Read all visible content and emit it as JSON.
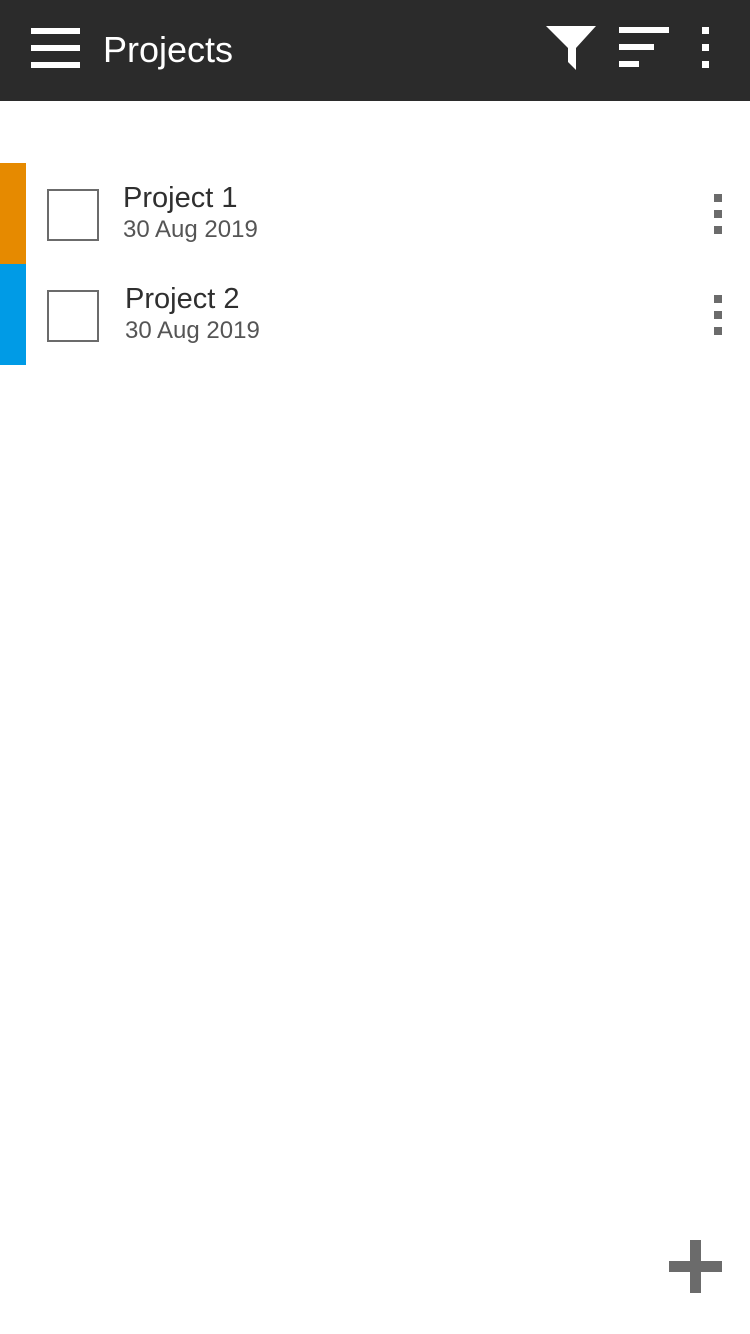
{
  "app_bar": {
    "title": "Projects",
    "background": "#2b2b2b",
    "icons": {
      "menu": "hamburger-menu-icon",
      "filter": "funnel-filter-icon",
      "sort": "sort-lines-icon",
      "overflow": "vertical-dots-icon"
    }
  },
  "projects": [
    {
      "name": "Project 1",
      "date": "30 Aug 2019",
      "color": "#e68a00",
      "checked": false
    },
    {
      "name": "Project 2",
      "date": "30 Aug 2019",
      "color": "#009be6",
      "checked": false
    }
  ],
  "fab": {
    "icon": "plus-icon",
    "color": "#6b6b6b"
  }
}
